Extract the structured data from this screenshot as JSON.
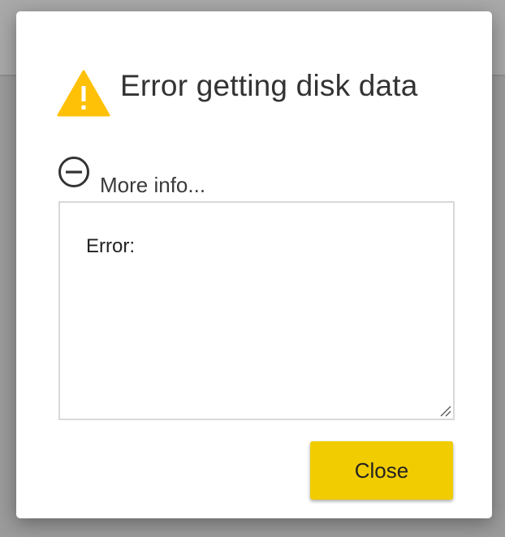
{
  "dialog": {
    "title": "Error getting disk data",
    "title_icon": "warning-icon",
    "more_info": {
      "icon": "minus-circle-icon",
      "label": "More info...",
      "expanded": true
    },
    "details_text": "Error:",
    "close_label": "Close"
  },
  "colors": {
    "accent": "#f0cc00",
    "warning": "#ffc107",
    "overlay": "#9b9b9b"
  }
}
